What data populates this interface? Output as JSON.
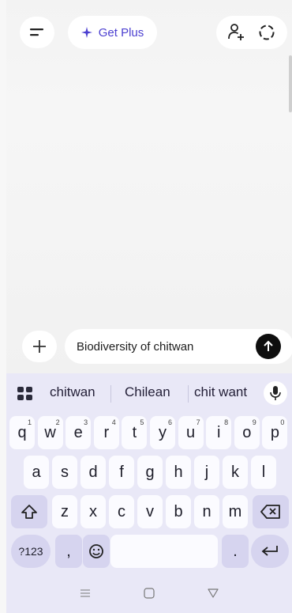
{
  "header": {
    "menu_icon": "menu-icon",
    "get_plus_label": "Get Plus",
    "sparkle_icon": "sparkle-icon",
    "add_person_icon": "add-person-icon",
    "temporary_chat_icon": "dashed-circle-icon"
  },
  "composer": {
    "add_icon": "plus-icon",
    "input_value": "Biodiversity of chitwan",
    "send_icon": "arrow-up-icon"
  },
  "keyboard": {
    "suggestions": [
      "chitwan",
      "Chilean",
      "chit want"
    ],
    "row1": [
      {
        "k": "q",
        "s": "1"
      },
      {
        "k": "w",
        "s": "2"
      },
      {
        "k": "e",
        "s": "3"
      },
      {
        "k": "r",
        "s": "4"
      },
      {
        "k": "t",
        "s": "5"
      },
      {
        "k": "y",
        "s": "6"
      },
      {
        "k": "u",
        "s": "7"
      },
      {
        "k": "i",
        "s": "8"
      },
      {
        "k": "o",
        "s": "9"
      },
      {
        "k": "p",
        "s": "0"
      }
    ],
    "row2": [
      "a",
      "s",
      "d",
      "f",
      "g",
      "h",
      "j",
      "k",
      "l"
    ],
    "row3": [
      "z",
      "x",
      "c",
      "v",
      "b",
      "n",
      "m"
    ],
    "sym_label": "?123",
    "comma": ",",
    "period": "."
  },
  "colors": {
    "accent": "#4b3fd0",
    "keyboard_bg": "#e9e8f7",
    "send_bg": "#0e0e0e"
  }
}
